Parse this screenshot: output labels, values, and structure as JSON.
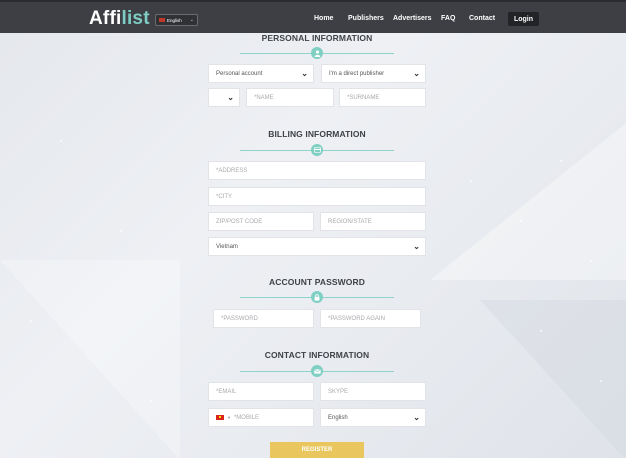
{
  "header": {
    "logo_part1": "Affi",
    "logo_part2": "list",
    "language": "English",
    "nav": [
      "Home",
      "Publishers",
      "Advertisers",
      "FAQ",
      "Contact"
    ],
    "login": "Login"
  },
  "personal": {
    "title": "PERSONAL INFORMATION",
    "account_type": "Personal account",
    "publisher_type": "I'm a direct publisher",
    "name_placeholder": "*NAME",
    "surname_placeholder": "*SURNAME"
  },
  "billing": {
    "title": "BILLING INFORMATION",
    "address_placeholder": "*ADDRESS",
    "city_placeholder": "*CITY",
    "zip_placeholder": "ZIP/POST CODE",
    "region_placeholder": "REGION/STATE",
    "country": "Vietnam"
  },
  "password": {
    "title": "ACCOUNT PASSWORD",
    "password_placeholder": "*PASSWORD",
    "password_again_placeholder": "*PASSWORD AGAIN"
  },
  "contact": {
    "title": "CONTACT INFORMATION",
    "email_placeholder": "*EMAIL",
    "skype_placeholder": "SKYPE",
    "mobile_placeholder": "*MOBILE",
    "language": "English"
  },
  "register_label": "REGISTER",
  "colors": {
    "accent": "#7fcfc3",
    "header_bg": "#3d3f44",
    "button": "#e9c75e"
  },
  "icons": {
    "personal": "user-icon",
    "billing": "card-icon",
    "password": "lock-icon",
    "contact": "envelope-icon"
  }
}
